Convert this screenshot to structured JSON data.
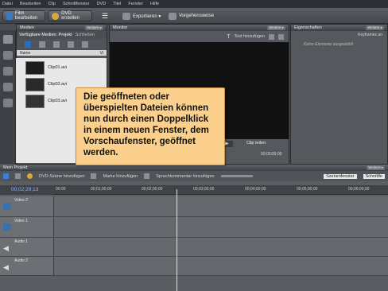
{
  "menu": [
    "Datei",
    "Bearbeiten",
    "Clip",
    "Schnittfenster",
    "DVD",
    "Titel",
    "Fenster",
    "Hilfe"
  ],
  "toolbar": {
    "film_label": "Film bearbeiten",
    "dvd_label": "DVD erstellen",
    "export_label": "Exportieren ▾",
    "preview_label": "Vorgehensweise"
  },
  "media": {
    "header": "Medien",
    "weitere": "Weitere ▸",
    "tab_available": "Verfügbare Medien: Projekt",
    "tab_close": "Schließen",
    "col_name": "Name",
    "col_vi": "Vi",
    "clips": [
      "Clip01.avi",
      "Clip02.avi",
      "Clip03.avi"
    ]
  },
  "monitor": {
    "header": "Monitor",
    "weitere": "Weitere ▸",
    "add_text": "Text hinzufügen",
    "clip_split": "Clip teilen",
    "timecode": "00;00;00;00"
  },
  "properties": {
    "header": "Eigenschaften",
    "weitere": "Weitere ▸",
    "keyframes": "Keyframes an",
    "empty": "Keine Elemente ausgewählt"
  },
  "project": {
    "header": "Mein Projekt",
    "weitere": "Weitere ▸",
    "add_scene": "DVD-Szene hinzufügen",
    "add_marker": "Marke hinzufügen",
    "add_narration": "Sprachkommentar hinzufügen",
    "scene_window": "Szenenfenster",
    "timeline_tab": "Schnittfe",
    "current_time": "00;02;29;13",
    "ruler": [
      "00:00",
      "00;01;00;00",
      "00;02;00;00",
      "00;03;00;00",
      "00;04;00;00",
      "00;05;00;00",
      "00;06;00;00"
    ],
    "tracks": [
      "Video 2",
      "Video 1",
      "Audio 1",
      "Audio 2"
    ]
  },
  "callout": {
    "text": "Die geöffneten oder überspielten Dateien können nun durch einen Doppelklick in einem neuen Fenster, dem Vorschaufenster, geöffnet werden."
  }
}
